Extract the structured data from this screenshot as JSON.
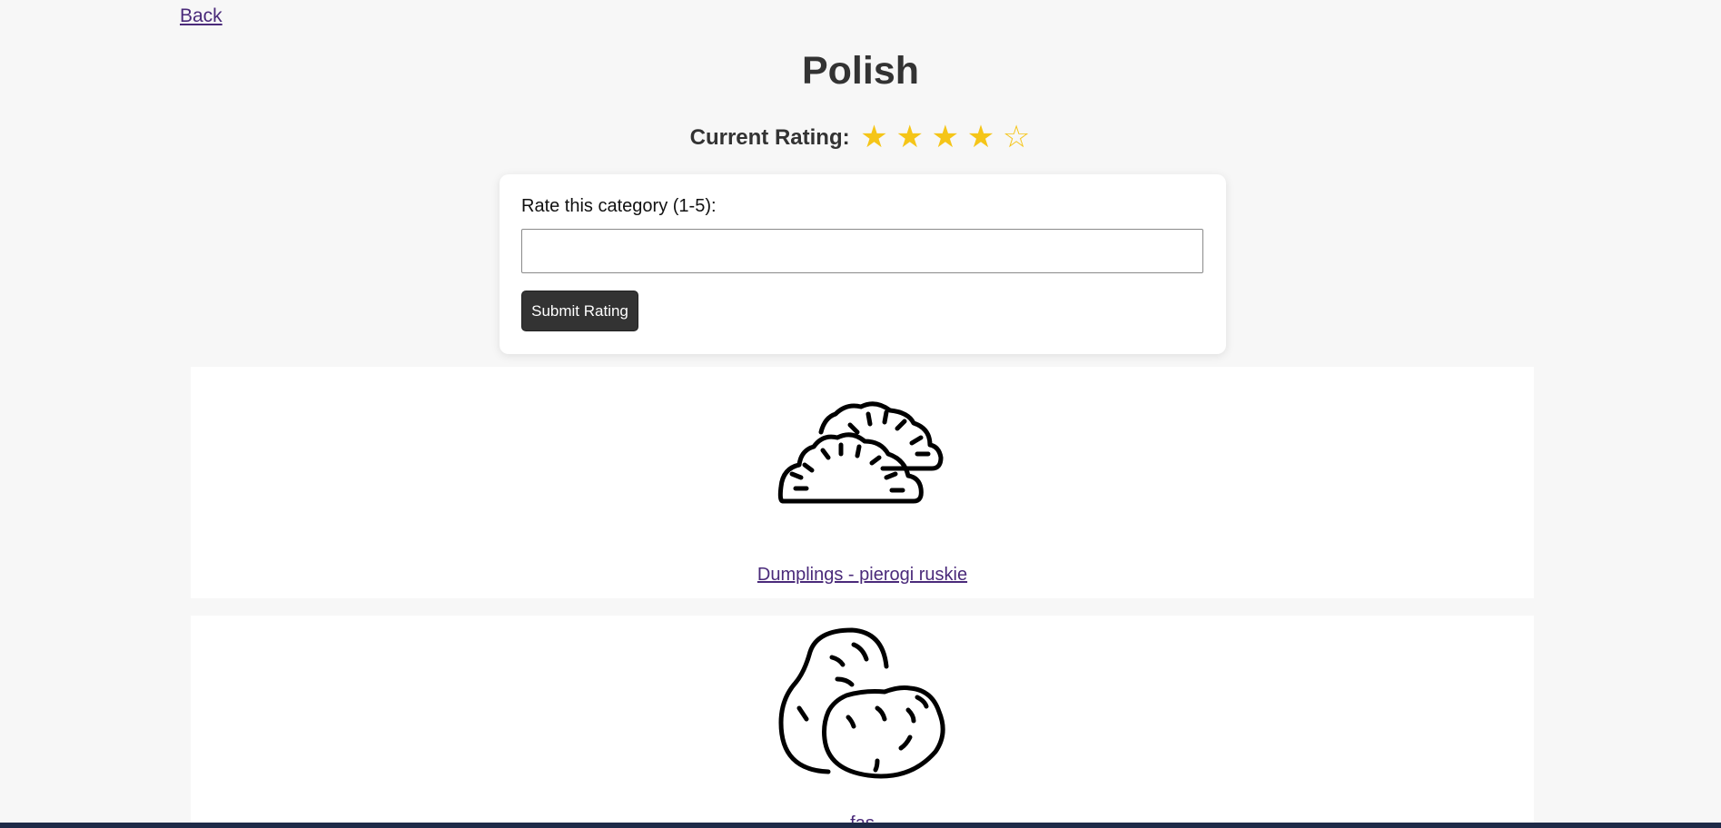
{
  "nav": {
    "back_label": "Back"
  },
  "page": {
    "title": "Polish"
  },
  "rating": {
    "label": "Current Rating:",
    "value": 4,
    "max": 5,
    "stars": [
      "★",
      "★",
      "★",
      "★",
      "☆"
    ],
    "star_color": "#f5c518"
  },
  "rate_form": {
    "label": "Rate this category (1-5):",
    "input_value": "",
    "submit_label": "Submit Rating"
  },
  "items": [
    {
      "name": "Dumplings - pierogi ruskie",
      "icon": "dumplings-icon"
    },
    {
      "name": "fas",
      "icon": "potatoes-icon"
    }
  ],
  "colors": {
    "background": "#f7f7f7",
    "link": "#4a2a7a",
    "button_bg": "#333333",
    "text": "#333333"
  }
}
